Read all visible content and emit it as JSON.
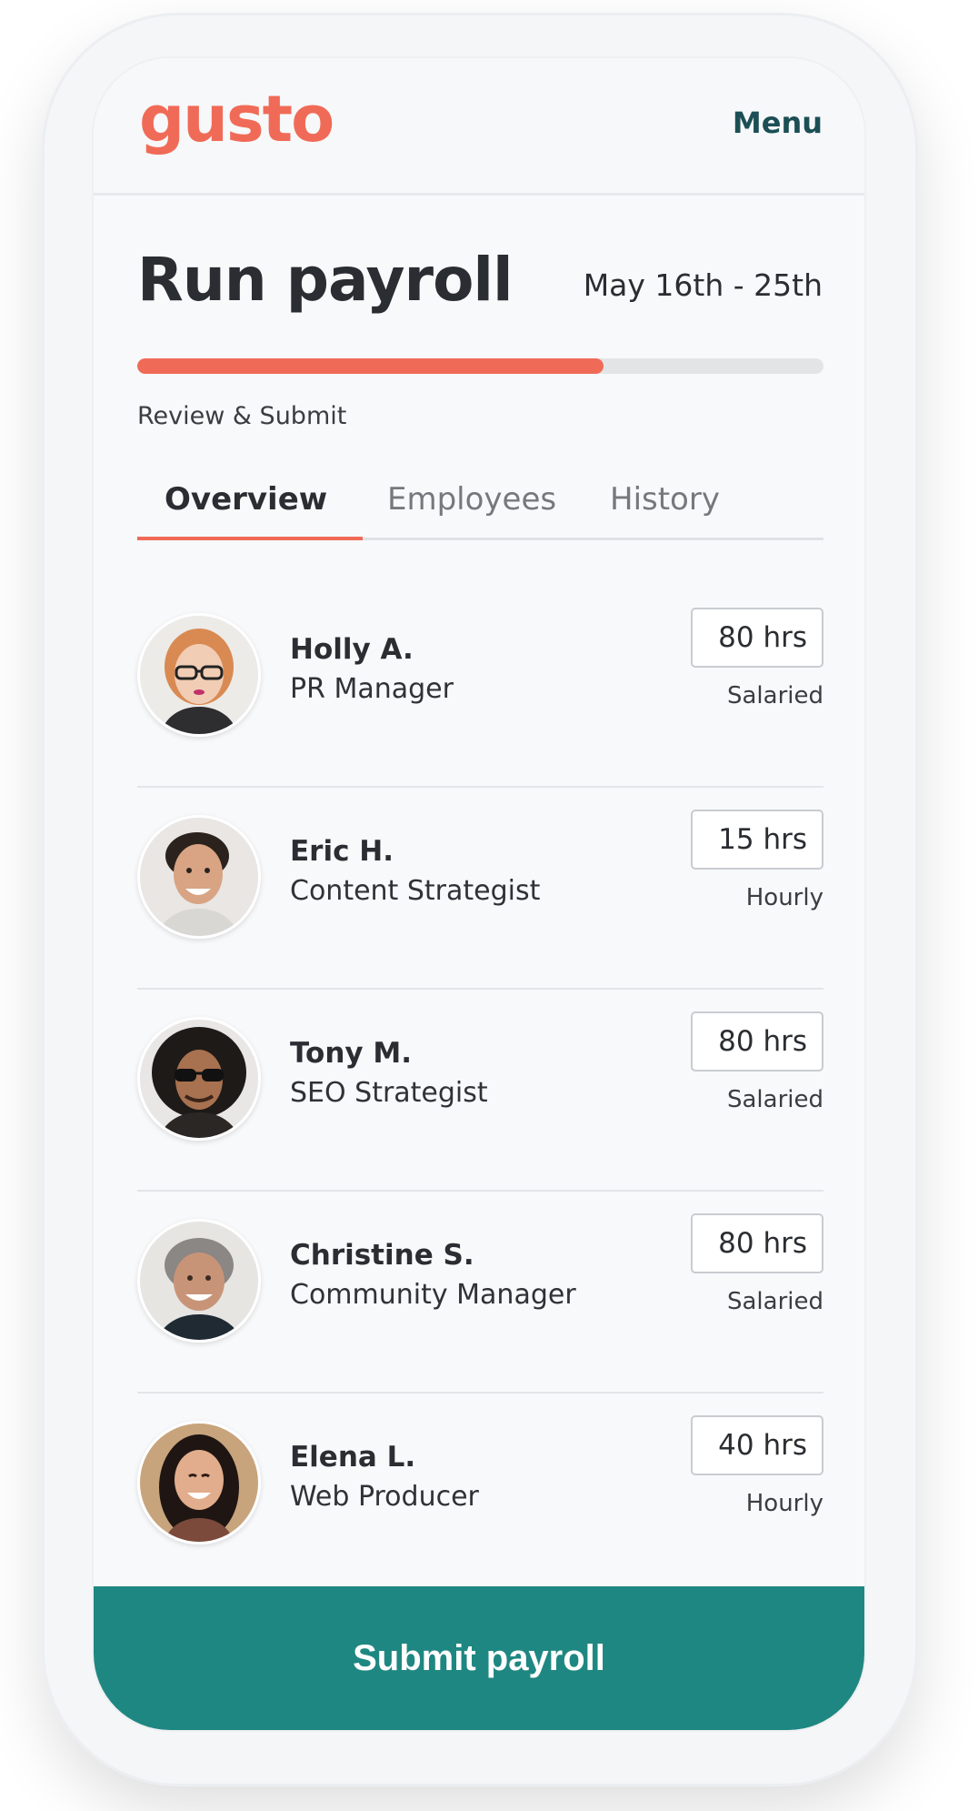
{
  "header": {
    "logo_text": "gusto",
    "menu_label": "Menu",
    "brand_color": "#f06b57",
    "accent_color": "#1f8781"
  },
  "payroll": {
    "title": "Run payroll",
    "date_range": "May 16th - 25th",
    "progress_fraction": 0.68,
    "step_label": "Review & Submit"
  },
  "tabs": [
    {
      "label": "Overview",
      "active": true
    },
    {
      "label": "Employees",
      "active": false
    },
    {
      "label": "History",
      "active": false
    }
  ],
  "employees": [
    {
      "name": "Holly A.",
      "role": "PR Manager",
      "hours": "80 hrs",
      "pay_type": "Salaried"
    },
    {
      "name": "Eric H.",
      "role": "Content Strategist",
      "hours": "15 hrs",
      "pay_type": "Hourly"
    },
    {
      "name": "Tony M.",
      "role": "SEO Strategist",
      "hours": "80 hrs",
      "pay_type": "Salaried"
    },
    {
      "name": "Christine S.",
      "role": "Community Manager",
      "hours": "80 hrs",
      "pay_type": "Salaried"
    },
    {
      "name": "Elena L.",
      "role": "Web Producer",
      "hours": "40 hrs",
      "pay_type": "Hourly"
    }
  ],
  "footer": {
    "submit_label": "Submit payroll"
  }
}
